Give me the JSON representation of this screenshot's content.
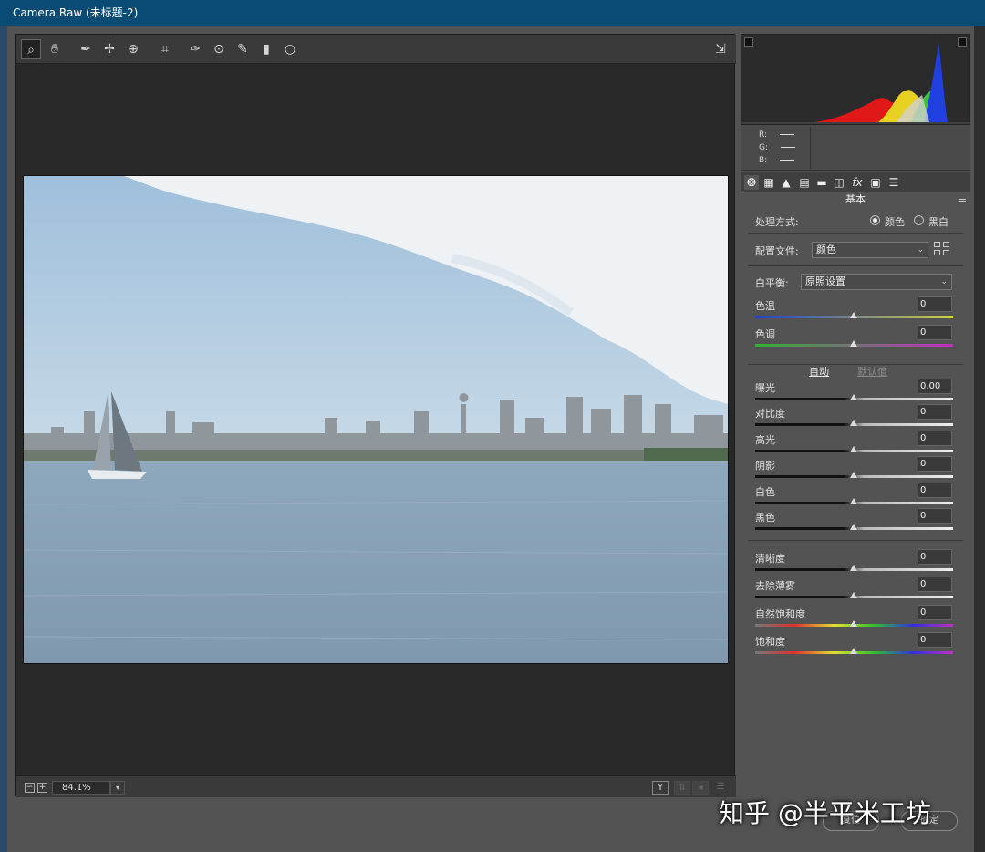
{
  "window": {
    "title": "Camera Raw (未标题-2)"
  },
  "toolbar": {
    "tools": [
      {
        "name": "zoom-tool",
        "icon": "magnifier-icon",
        "glyph": "🔍︎",
        "active": true
      },
      {
        "name": "hand-tool",
        "icon": "hand-icon",
        "glyph": "✋︎"
      },
      {
        "name": "white-balance-tool",
        "icon": "eyedropper-icon",
        "glyph": "⁄"
      },
      {
        "name": "color-sampler-tool",
        "icon": "color-sampler-icon",
        "glyph": "✧"
      },
      {
        "name": "targeted-adjustment-tool",
        "icon": "target-adjust-icon",
        "glyph": "⊹"
      },
      {
        "name": "crop-tool",
        "icon": "crop-icon",
        "glyph": "⌗"
      },
      {
        "name": "spot-removal-tool",
        "icon": "spot-removal-icon",
        "glyph": "✑"
      },
      {
        "name": "red-eye-tool",
        "icon": "red-eye-icon",
        "glyph": "◉"
      },
      {
        "name": "adjustment-brush-tool",
        "icon": "brush-icon",
        "glyph": "✎"
      },
      {
        "name": "graduated-filter-tool",
        "icon": "graduated-filter-icon",
        "glyph": "▮"
      },
      {
        "name": "radial-filter-tool",
        "icon": "radial-filter-icon",
        "glyph": "○"
      }
    ],
    "fullscreen_icon": "exit-fullscreen-icon"
  },
  "status": {
    "zoom": "84.1%"
  },
  "histogram": {
    "r_label": "R:",
    "g_label": "G:",
    "b_label": "B:"
  },
  "panel": {
    "section_title": "基本",
    "treatment_label": "处理方式:",
    "treatment_color": "颜色",
    "treatment_bw": "黑白",
    "profile_label": "配置文件:",
    "profile_value": "颜色",
    "wb_label": "白平衡:",
    "wb_value": "原照设置",
    "auto_label": "自动",
    "default_label": "默认值",
    "sliders": [
      {
        "key": "temp",
        "label": "色温",
        "value": "0"
      },
      {
        "key": "tint",
        "label": "色调",
        "value": "0"
      },
      {
        "key": "exposure",
        "label": "曝光",
        "value": "0.00"
      },
      {
        "key": "contrast",
        "label": "对比度",
        "value": "0"
      },
      {
        "key": "highlights",
        "label": "高光",
        "value": "0"
      },
      {
        "key": "shadows",
        "label": "阴影",
        "value": "0"
      },
      {
        "key": "whites",
        "label": "白色",
        "value": "0"
      },
      {
        "key": "blacks",
        "label": "黑色",
        "value": "0"
      },
      {
        "key": "clarity",
        "label": "清晰度",
        "value": "0"
      },
      {
        "key": "dehaze",
        "label": "去除薄雾",
        "value": "0"
      },
      {
        "key": "vibrance",
        "label": "自然饱和度",
        "value": "0"
      },
      {
        "key": "saturation",
        "label": "饱和度",
        "value": "0"
      }
    ]
  },
  "footer": {
    "reset_label": "复位",
    "ok_label": "确定"
  },
  "watermark": "知乎 @半平米工坊",
  "colors": {
    "titlebar": "#0a4b76",
    "panel": "#535353",
    "canvas": "#282828"
  }
}
